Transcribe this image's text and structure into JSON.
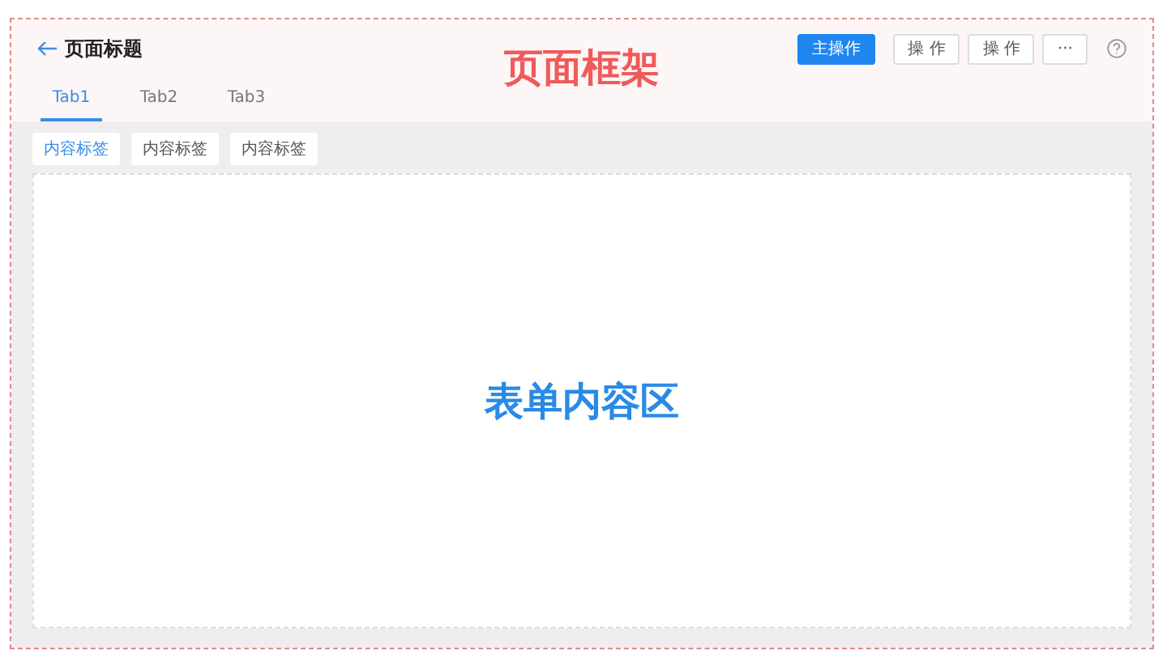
{
  "header": {
    "title": "页面标题",
    "annotation": "页面框架"
  },
  "actions": [
    {
      "label": "主操作",
      "kind": "primary"
    },
    {
      "label": "操 作",
      "kind": "default"
    },
    {
      "label": "操 作",
      "kind": "default"
    },
    {
      "label": "···",
      "kind": "default"
    }
  ],
  "tabs": [
    {
      "label": "Tab1",
      "selected": true
    },
    {
      "label": "Tab2",
      "selected": false
    },
    {
      "label": "Tab3",
      "selected": false
    }
  ],
  "content_tags": [
    {
      "label": "内容标签",
      "selected": true
    },
    {
      "label": "内容标签",
      "selected": false
    },
    {
      "label": "内容标签",
      "selected": false
    }
  ],
  "content": {
    "annotation": "表单内容区"
  }
}
